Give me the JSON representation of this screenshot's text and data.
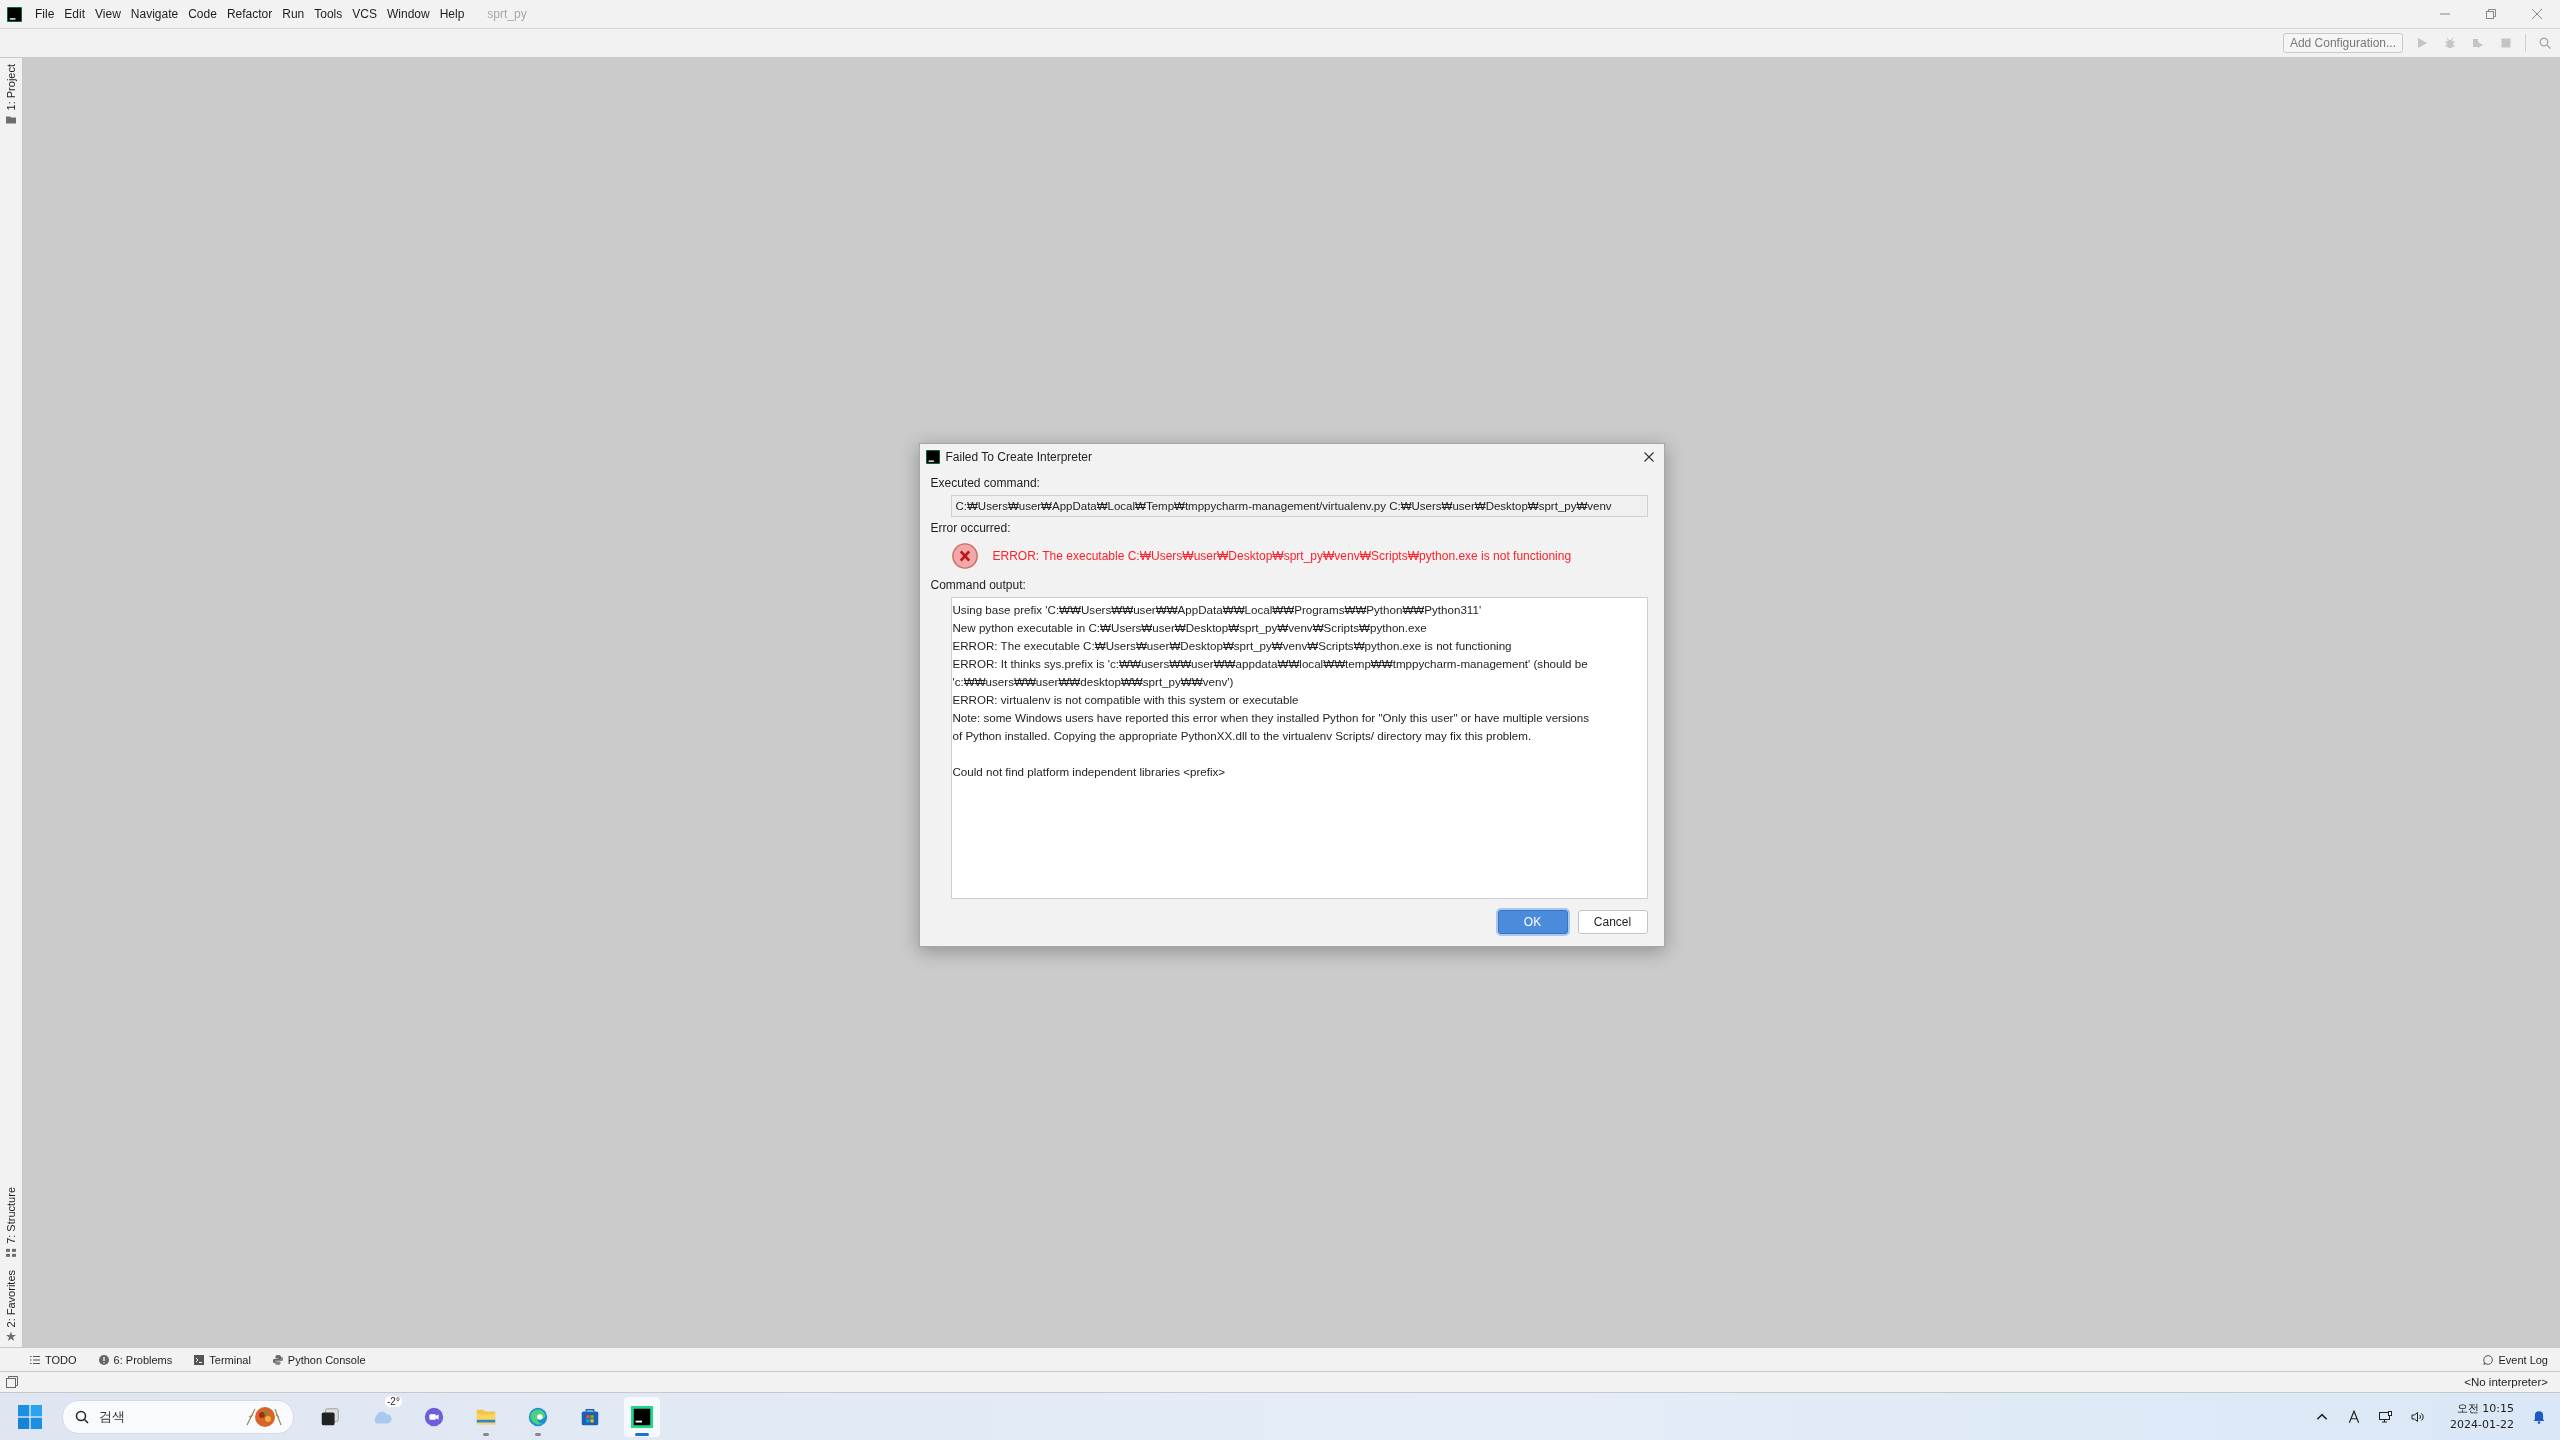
{
  "menu_bar": {
    "menus": [
      "File",
      "Edit",
      "View",
      "Navigate",
      "Code",
      "Refactor",
      "Run",
      "Tools",
      "VCS",
      "Window",
      "Help"
    ],
    "project": "sprt_py"
  },
  "toolbar": {
    "configuration_button": "Add Configuration..."
  },
  "left_tool_strip": {
    "top": [
      {
        "label": "1: Project",
        "kind": "folder"
      }
    ],
    "bottom": [
      {
        "label": "7: Structure",
        "kind": "structure"
      },
      {
        "label": "2: Favorites",
        "kind": "star"
      }
    ]
  },
  "dialog": {
    "title": "Failed To Create Interpreter",
    "executed_label": "Executed command:",
    "command": "C:₩Users₩user₩AppData₩Local₩Temp₩tmppycharm-management/virtualenv.py C:₩Users₩user₩Desktop₩sprt_py₩venv",
    "error_label": "Error occurred:",
    "error_message": "ERROR: The executable C:₩Users₩user₩Desktop₩sprt_py₩venv₩Scripts₩python.exe is not functioning",
    "output_label": "Command output:",
    "output": [
      [
        "Using base prefix 'C:₩₩Users₩₩user₩₩AppData₩₩Local₩₩Programs₩₩Python₩₩Python311'",
        "New python executable in C:₩Users₩user₩Desktop₩sprt_py₩venv₩Scripts₩python.exe",
        "ERROR: The executable C:₩Users₩user₩Desktop₩sprt_py₩venv₩Scripts₩python.exe is not functioning",
        "ERROR: It thinks sys.prefix is 'c:₩₩users₩₩user₩₩appdata₩₩local₩₩temp₩₩tmppycharm-management' (should be",
        "'c:₩₩users₩₩user₩₩desktop₩₩sprt_py₩₩venv')",
        "ERROR: virtualenv is not compatible with this system or executable",
        "Note: some Windows users have reported this error when they installed Python for \"Only this user\" or have multiple versions",
        "of Python installed. Copying the appropriate PythonXX.dll to the virtualenv Scripts/ directory may fix this problem."
      ],
      [
        "Could not find platform independent libraries <prefix>"
      ]
    ],
    "buttons": [
      {
        "label": "OK",
        "default": true
      },
      {
        "label": "Cancel",
        "default": false
      }
    ]
  },
  "tool_tabs": [
    {
      "label": "TODO",
      "kind": "list"
    },
    {
      "label": "6: Problems",
      "kind": "problems"
    },
    {
      "label": "Terminal",
      "kind": "terminal"
    },
    {
      "label": "Python Console",
      "kind": "python"
    }
  ],
  "event_log": "Event Log",
  "status_bar": {
    "interpreter": "<No interpreter>"
  },
  "taskbar": {
    "search_placeholder": "검색",
    "weather": "-2°",
    "apps": [
      {
        "kind": "taskview",
        "running": false,
        "selected": false
      },
      {
        "kind": "weather",
        "running": false,
        "selected": false
      },
      {
        "kind": "chat",
        "running": false,
        "selected": false
      },
      {
        "kind": "explorer",
        "running": true,
        "selected": false
      },
      {
        "kind": "edge",
        "running": true,
        "selected": false
      },
      {
        "kind": "store",
        "running": false,
        "selected": false
      },
      {
        "kind": "pycharm",
        "running": true,
        "selected": true
      }
    ],
    "time": "오전 10:15",
    "date": "2024-01-22"
  }
}
